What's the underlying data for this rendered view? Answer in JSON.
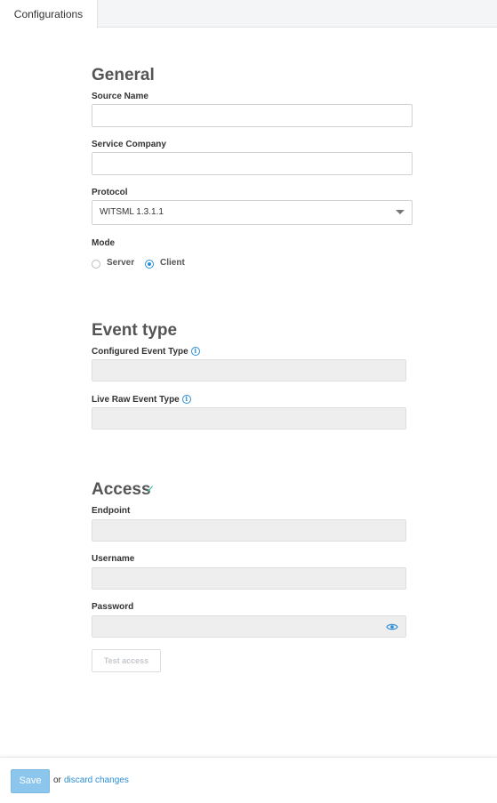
{
  "tabs": {
    "active": "Configurations"
  },
  "general": {
    "title": "General",
    "source_name_label": "Source Name",
    "source_name_value": "",
    "service_company_label": "Service Company",
    "service_company_value": "",
    "protocol_label": "Protocol",
    "protocol_value": "WITSML 1.3.1.1",
    "mode_label": "Mode",
    "mode_options": [
      "Server",
      "Client"
    ],
    "mode_selected": "Client"
  },
  "event_type": {
    "title": "Event type",
    "configured_label": "Configured Event Type",
    "configured_value": "",
    "live_raw_label": "Live Raw Event Type",
    "live_raw_value": ""
  },
  "access": {
    "title": "Access",
    "status": "check-icon",
    "endpoint_label": "Endpoint",
    "endpoint_value": "",
    "username_label": "Username",
    "username_value": "",
    "password_label": "Password",
    "password_value": "",
    "test_label": "Test access"
  },
  "footer": {
    "save_label": "Save",
    "or_text": "or",
    "discard_label": "discard changes"
  },
  "colors": {
    "accent": "#2d8fd5",
    "save_button": "#8cc6ec",
    "check": "#37b39b",
    "disabled_field": "#eeeeee"
  }
}
